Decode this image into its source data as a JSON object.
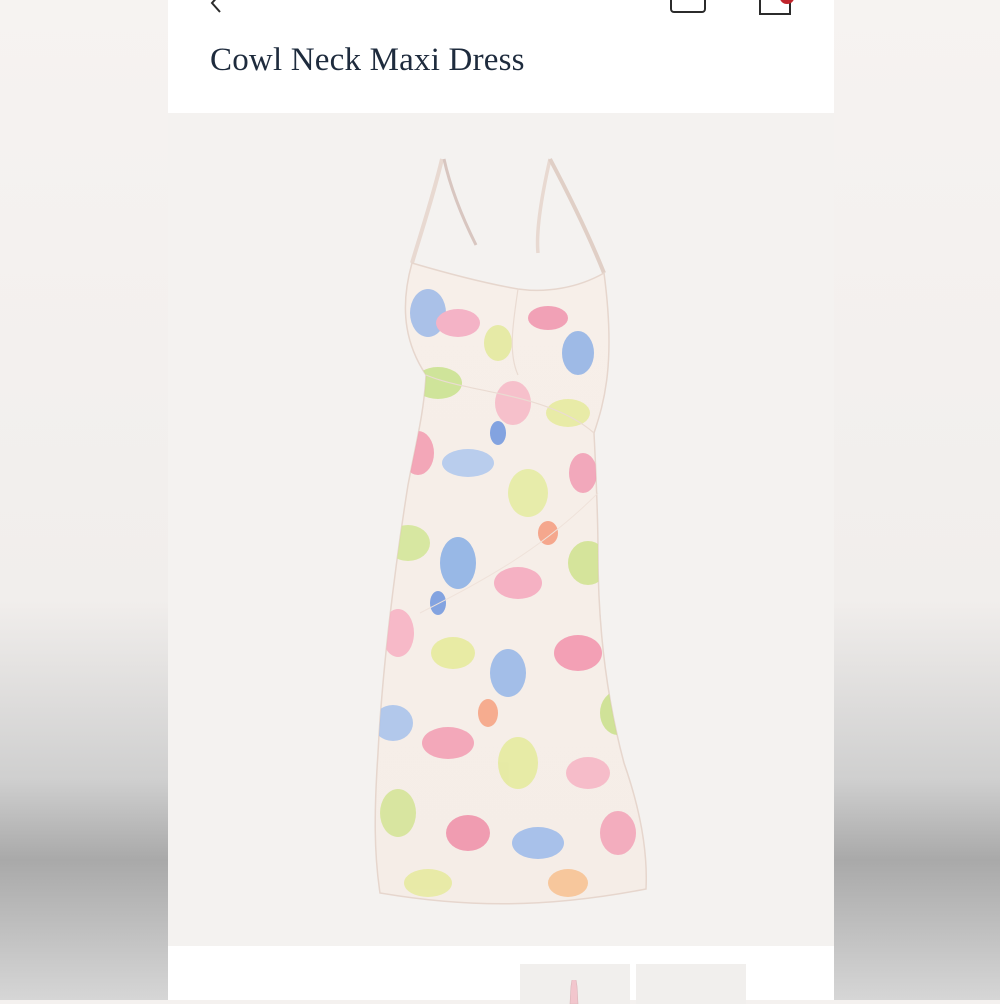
{
  "product": {
    "title": "Cowl Neck Maxi Dress"
  },
  "icons": {
    "back": "chevron-left-icon",
    "account": "account-icon",
    "bag": "shopping-bag-icon"
  },
  "colors": {
    "title": "#1e2b3d",
    "badge": "#c0242b",
    "image_background": "#f4f2f0"
  },
  "gallery": {
    "thumbnail_count_visible": 2,
    "selected_index": 0
  }
}
